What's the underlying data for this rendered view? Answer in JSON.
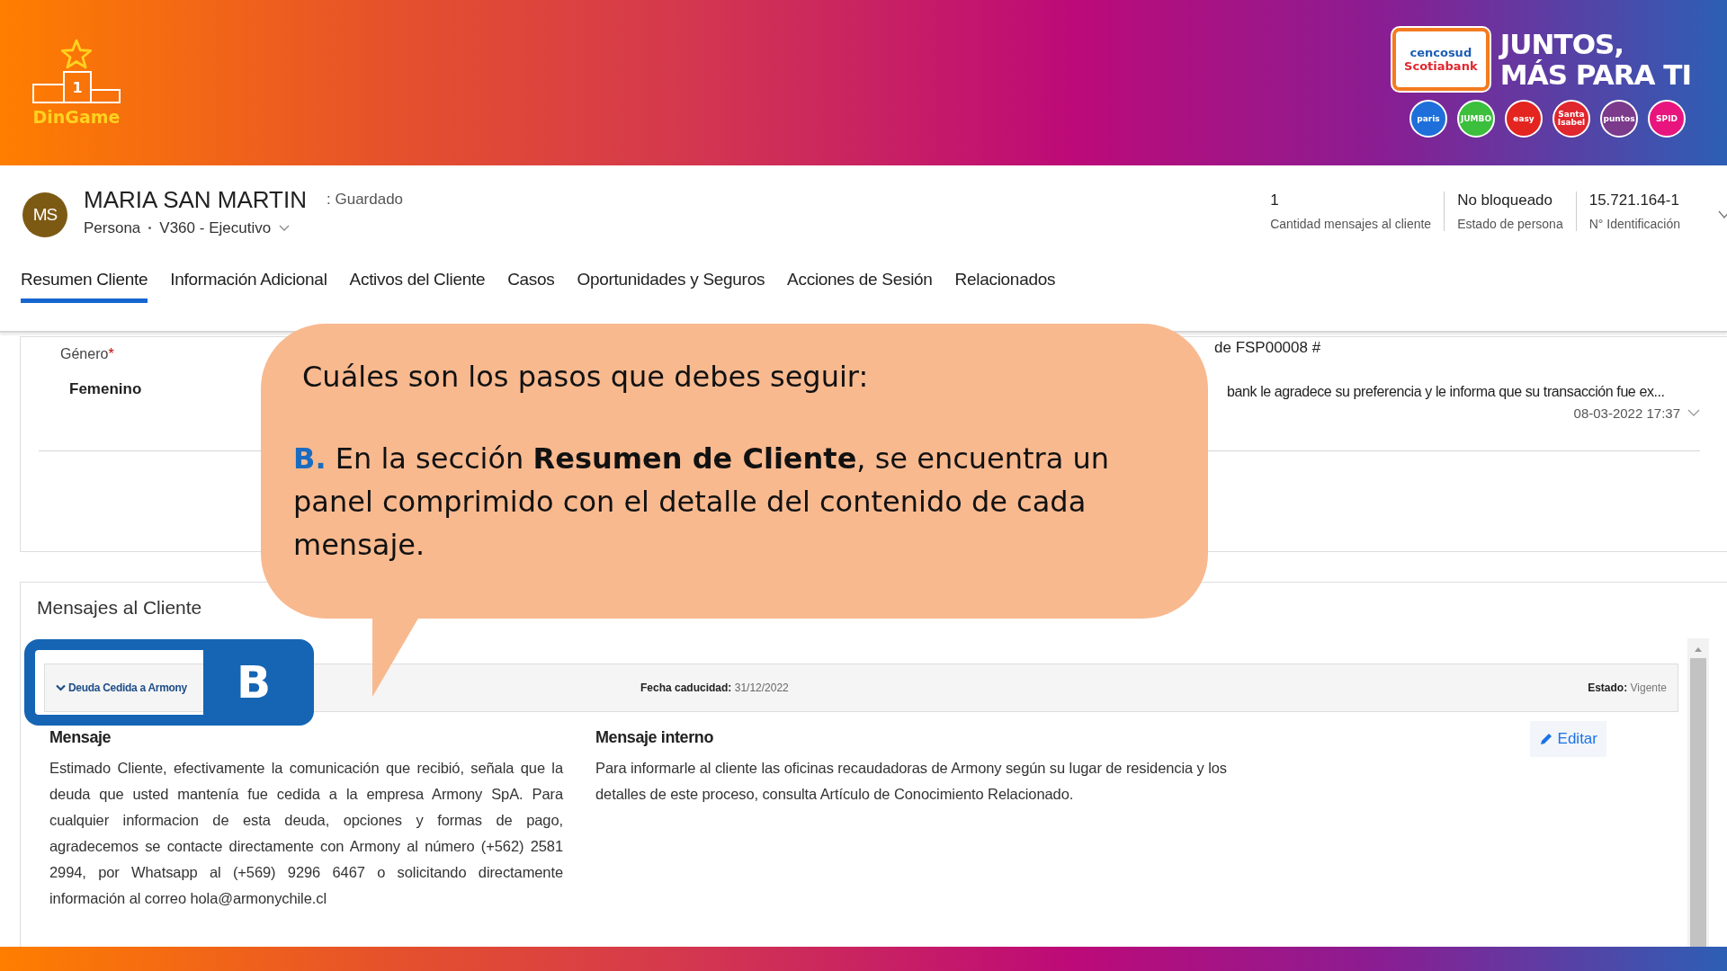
{
  "banner": {
    "app_name": "DinGame",
    "podium_number": "1",
    "partner": {
      "brand_lines": [
        "cencosud",
        "Scotiabank"
      ],
      "slogan_lines": [
        "JUNTOS,",
        "MÁS PARA TI"
      ],
      "stores": [
        {
          "name": "paris",
          "color": "#1e6fd9"
        },
        {
          "name": "JUMBO",
          "color": "#3cbf3c"
        },
        {
          "name": "easy",
          "color": "#e3241f"
        },
        {
          "name": "Santa Isabel",
          "color": "#e0262e"
        },
        {
          "name": "puntos",
          "color": "#7b3a8c"
        },
        {
          "name": "SPID",
          "color": "#e8157f"
        }
      ]
    }
  },
  "record": {
    "avatar": "MS",
    "name": "MARIA SAN MARTIN",
    "save_status": ": Guardado",
    "entity": "Persona",
    "form": "V360 - Ejecutivo",
    "stats": [
      {
        "value": "1",
        "label": "Cantidad mensajes al cliente"
      },
      {
        "value": "No bloqueado",
        "label": "Estado de persona"
      },
      {
        "value": "15.721.164-1",
        "label": "N° Identificación"
      }
    ]
  },
  "tabs": [
    {
      "label": "Resumen Cliente",
      "selected": true
    },
    {
      "label": "Información Adicional",
      "selected": false
    },
    {
      "label": "Activos del Cliente",
      "selected": false
    },
    {
      "label": "Casos",
      "selected": false
    },
    {
      "label": "Oportunidades y Seguros",
      "selected": false
    },
    {
      "label": "Acciones de Sesión",
      "selected": false
    },
    {
      "label": "Relacionados",
      "selected": false
    }
  ],
  "section": {
    "field_label": "Género",
    "required_mark": "*",
    "field_value": "Femenino",
    "timeline": {
      "title": "de FSP00008 #",
      "text": "bank le agradece su preferencia y le informa que su transacción fue ex...",
      "timestamp": "08-03-2022 17:37"
    }
  },
  "messages": {
    "title": "Mensajes al Cliente",
    "items": [
      {
        "subject": "Deuda Cedida a Armony",
        "expanded": true,
        "expiry_label": "Fecha caducidad:",
        "expiry": "31/12/2022",
        "status_label": "Estado:",
        "status": "Vigente",
        "message_label": "Mensaje",
        "message": "Estimado Cliente, efectivamente la comunicación que recibió, señala que la deuda que usted mantenía fue cedida a la empresa Armony SpA. Para cualquier informacion de esta deuda, opciones y formas de pago, agradecemos se contacte directamente con Armony al número (+562) 2581 2994, por Whatsapp al (+569) 9296 6467 o solicitando directamente información al correo hola@armonychile.cl",
        "internal_label": "Mensaje interno",
        "internal": "Para informarle al cliente las oficinas recaudadoras de Armony según su lugar de residencia y los detalles de este proceso, consulta Artículo de Conocimiento Relacionado.",
        "edit": "Editar"
      }
    ]
  },
  "callout": {
    "heading": "Cuáles son los pasos que debes seguir:",
    "step": "B.",
    "text": "En la sección **Resumen de Cliente**, se encuentra un panel comprimido con el detalle del contenido de cada mensaje."
  },
  "marker": {
    "letter": "B"
  }
}
